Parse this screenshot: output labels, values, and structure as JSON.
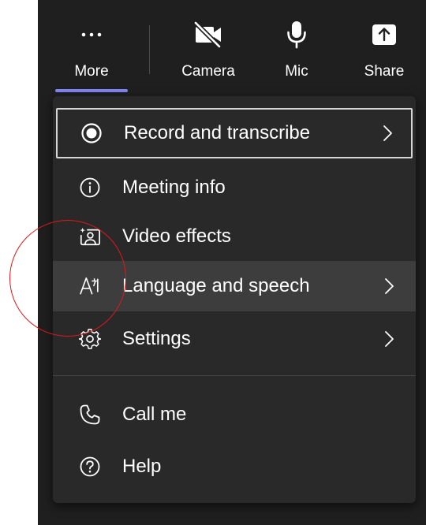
{
  "toolbar": {
    "more": {
      "label": "More",
      "icon": "more-icon"
    },
    "camera": {
      "label": "Camera",
      "icon": "camera-off-icon"
    },
    "mic": {
      "label": "Mic",
      "icon": "microphone-icon"
    },
    "share": {
      "label": "Share",
      "icon": "share-screen-icon"
    }
  },
  "menu": {
    "items": [
      {
        "label": "Record and transcribe",
        "icon": "record-icon",
        "submenu": true
      },
      {
        "label": "Meeting info",
        "icon": "info-icon",
        "submenu": false
      },
      {
        "label": "Video effects",
        "icon": "video-effects-icon",
        "submenu": false
      },
      {
        "label": "Language and speech",
        "icon": "language-icon",
        "submenu": true
      },
      {
        "label": "Settings",
        "icon": "gear-icon",
        "submenu": true
      },
      {
        "label": "Call me",
        "icon": "phone-icon",
        "submenu": false
      },
      {
        "label": "Help",
        "icon": "help-icon",
        "submenu": false
      }
    ]
  },
  "colors": {
    "background": "#1f1f1f",
    "menu_background": "#292929",
    "accent": "#7f85f5",
    "annotation": "#e0181b"
  }
}
